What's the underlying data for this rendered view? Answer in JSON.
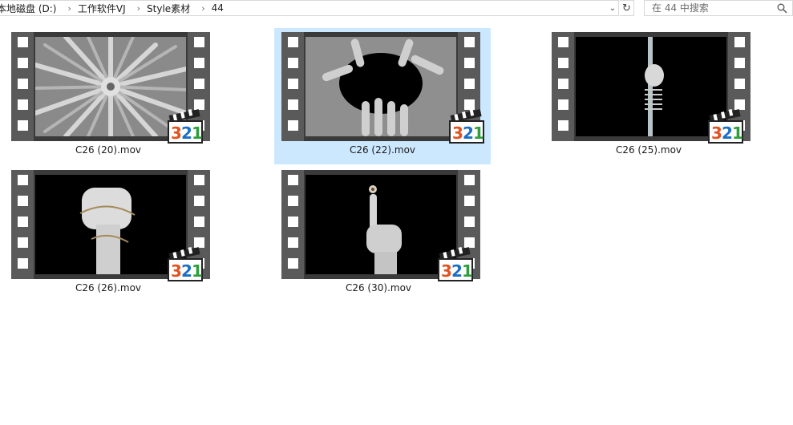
{
  "breadcrumb": [
    "本地磁盘 (D:)",
    "工作软件VJ",
    "Style素材",
    "44"
  ],
  "search": {
    "placeholder": "在 44 中搜索"
  },
  "files": [
    {
      "name": "C26 (20).mov",
      "state": "normal",
      "thumb": "spiral-hands"
    },
    {
      "name": "C26 (22).mov",
      "state": "selected",
      "thumb": "hands-circle"
    },
    {
      "name": "C26 (25).mov",
      "state": "normal",
      "thumb": "skeleton-pole"
    },
    {
      "name": "C26 (26).mov",
      "state": "normal",
      "thumb": "chained-fist"
    },
    {
      "name": "C26 (30).mov",
      "state": "normal",
      "thumb": "eye-finger"
    }
  ],
  "badge": {
    "digits": [
      "3",
      "2",
      "1"
    ]
  },
  "colors": {
    "selected": "#cce8ff",
    "badge3": "#e0531f",
    "badge2": "#1a6fc4",
    "badge1": "#2e9e3a"
  }
}
